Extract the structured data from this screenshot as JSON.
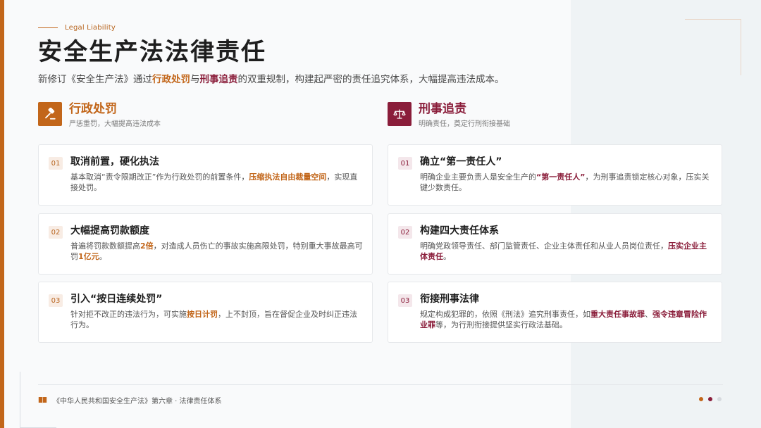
{
  "header": {
    "eyebrow": "Legal Liability",
    "title": "安全生产法法律责任",
    "subtitle": {
      "p1": "新修订《安全生产法》通过",
      "h1": "行政处罚",
      "p2": "与",
      "h2": "刑事追责",
      "p3": "的双重规制，构建起严密的责任追究体系，大幅提高违法成本。"
    }
  },
  "left_column": {
    "icon": "gavel-icon",
    "accent": "#c2661a",
    "title": "行政处罚",
    "subtitle": "严惩重罚，大幅提高违法成本",
    "cards": [
      {
        "num": "01",
        "title": "取消前置，硬化执法",
        "p1": "基本取消“责令限期改正”作为行政处罚的前置条件，",
        "h1": "压缩执法自由裁量空间",
        "p2": "，实现直接处罚。"
      },
      {
        "num": "02",
        "title": "大幅提高罚款额度",
        "p1": "普遍将罚款数额提高",
        "h1": "2倍",
        "p2": "，对造成人员伤亡的事故实施高限处罚，特别重大事故最高可罚",
        "h2": "1亿元",
        "p3": "。"
      },
      {
        "num": "03",
        "title": "引入“按日连续处罚”",
        "p1": "针对拒不改正的违法行为，可实施",
        "h1": "按日计罚",
        "p2": "，上不封顶，旨在督促企业及时纠正违法行为。"
      }
    ]
  },
  "right_column": {
    "icon": "scales-icon",
    "accent": "#8a1d3a",
    "title": "刑事追责",
    "subtitle": "明确责任，奠定行刑衔接基础",
    "cards": [
      {
        "num": "01",
        "title": "确立“第一责任人”",
        "p1": "明确企业主要负责人是安全生产的",
        "h1": "“第一责任人”",
        "p2": "，为刑事追责锁定核心对象，压实关键少数责任。"
      },
      {
        "num": "02",
        "title": "构建四大责任体系",
        "p1": "明确党政领导责任、部门监管责任、企业主体责任和从业人员岗位责任，",
        "h1": "压实企业主体责任",
        "p2": "。"
      },
      {
        "num": "03",
        "title": "衔接刑事法律",
        "p1": "规定构成犯罪的，依照《刑法》追究刑事责任，如",
        "h1": "重大责任事故罪",
        "p2": "、",
        "h2": "强令违章冒险作业罪",
        "p3": "等，为行刑衔接提供坚实行政法基础。"
      }
    ]
  },
  "footer": {
    "icon": "book-icon",
    "text": "《中华人民共和国安全生产法》第六章 · 法律责任体系",
    "page_dots": [
      "#c2661a",
      "#8a1d3a",
      "#d6d9de"
    ]
  }
}
